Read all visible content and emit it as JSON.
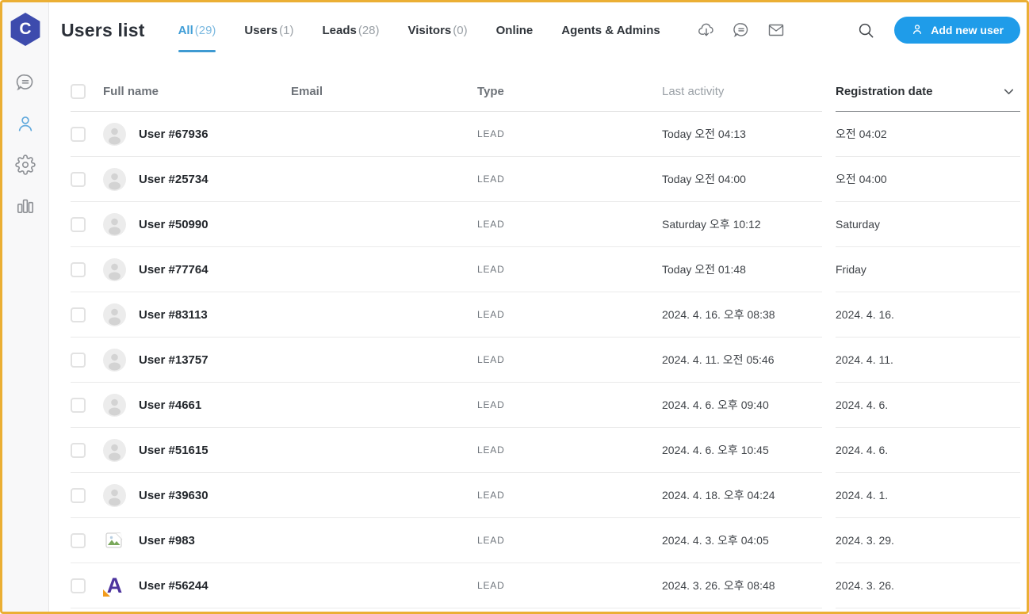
{
  "colors": {
    "window_border": "#EBAF34",
    "accent_blue": "#3e9ad2",
    "button_blue": "#1f9ce9",
    "logo_indigo": "#3d4bad"
  },
  "sidebar": {
    "logo_letter": "C",
    "items": [
      {
        "name": "chats",
        "icon": "chat-bubble-icon",
        "active": false
      },
      {
        "name": "users",
        "icon": "user-icon",
        "active": true
      },
      {
        "name": "settings",
        "icon": "gear-icon",
        "active": false
      },
      {
        "name": "reports",
        "icon": "bar-chart-icon",
        "active": false
      }
    ]
  },
  "header": {
    "title": "Users list",
    "tabs": [
      {
        "label": "All",
        "count": "(29)",
        "active": true
      },
      {
        "label": "Users",
        "count": "(1)",
        "active": false
      },
      {
        "label": "Leads",
        "count": "(28)",
        "active": false
      },
      {
        "label": "Visitors",
        "count": "(0)",
        "active": false
      },
      {
        "label": "Online",
        "count": "",
        "active": false
      },
      {
        "label": "Agents & Admins",
        "count": "",
        "active": false
      }
    ],
    "action_icons": [
      "cloud-download-icon",
      "chat-bubble-icon",
      "mail-icon"
    ],
    "add_user_label": "Add new user"
  },
  "table": {
    "columns": {
      "full_name": "Full name",
      "email": "Email",
      "type": "Type",
      "last_activity": "Last activity",
      "registration_date": "Registration date"
    },
    "sorted_by": "Registration date",
    "rows": [
      {
        "name": "User #67936",
        "email": "",
        "type": "LEAD",
        "last_activity": "Today 오전 04:13",
        "registration": "오전 04:02",
        "avatar": "placeholder"
      },
      {
        "name": "User #25734",
        "email": "",
        "type": "LEAD",
        "last_activity": "Today 오전 04:00",
        "registration": "오전 04:00",
        "avatar": "placeholder"
      },
      {
        "name": "User #50990",
        "email": "",
        "type": "LEAD",
        "last_activity": "Saturday 오후 10:12",
        "registration": "Saturday",
        "avatar": "placeholder"
      },
      {
        "name": "User #77764",
        "email": "",
        "type": "LEAD",
        "last_activity": "Today 오전 01:48",
        "registration": "Friday",
        "avatar": "placeholder"
      },
      {
        "name": "User #83113",
        "email": "",
        "type": "LEAD",
        "last_activity": "2024. 4. 16. 오후 08:38",
        "registration": "2024. 4. 16.",
        "avatar": "placeholder"
      },
      {
        "name": "User #13757",
        "email": "",
        "type": "LEAD",
        "last_activity": "2024. 4. 11. 오전 05:46",
        "registration": "2024. 4. 11.",
        "avatar": "placeholder"
      },
      {
        "name": "User #4661",
        "email": "",
        "type": "LEAD",
        "last_activity": "2024. 4. 6. 오후 09:40",
        "registration": "2024. 4. 6.",
        "avatar": "placeholder"
      },
      {
        "name": "User #51615",
        "email": "",
        "type": "LEAD",
        "last_activity": "2024. 4. 6. 오후 10:45",
        "registration": "2024. 4. 6.",
        "avatar": "placeholder"
      },
      {
        "name": "User #39630",
        "email": "",
        "type": "LEAD",
        "last_activity": "2024. 4. 18. 오후 04:24",
        "registration": "2024. 4. 1.",
        "avatar": "placeholder"
      },
      {
        "name": "User #983",
        "email": "",
        "type": "LEAD",
        "last_activity": "2024. 4. 3. 오후 04:05",
        "registration": "2024. 3. 29.",
        "avatar": "broken-image"
      },
      {
        "name": "User #56244",
        "email": "",
        "type": "LEAD",
        "last_activity": "2024. 3. 26. 오후 08:48",
        "registration": "2024. 3. 26.",
        "avatar": "letter-a"
      }
    ]
  }
}
